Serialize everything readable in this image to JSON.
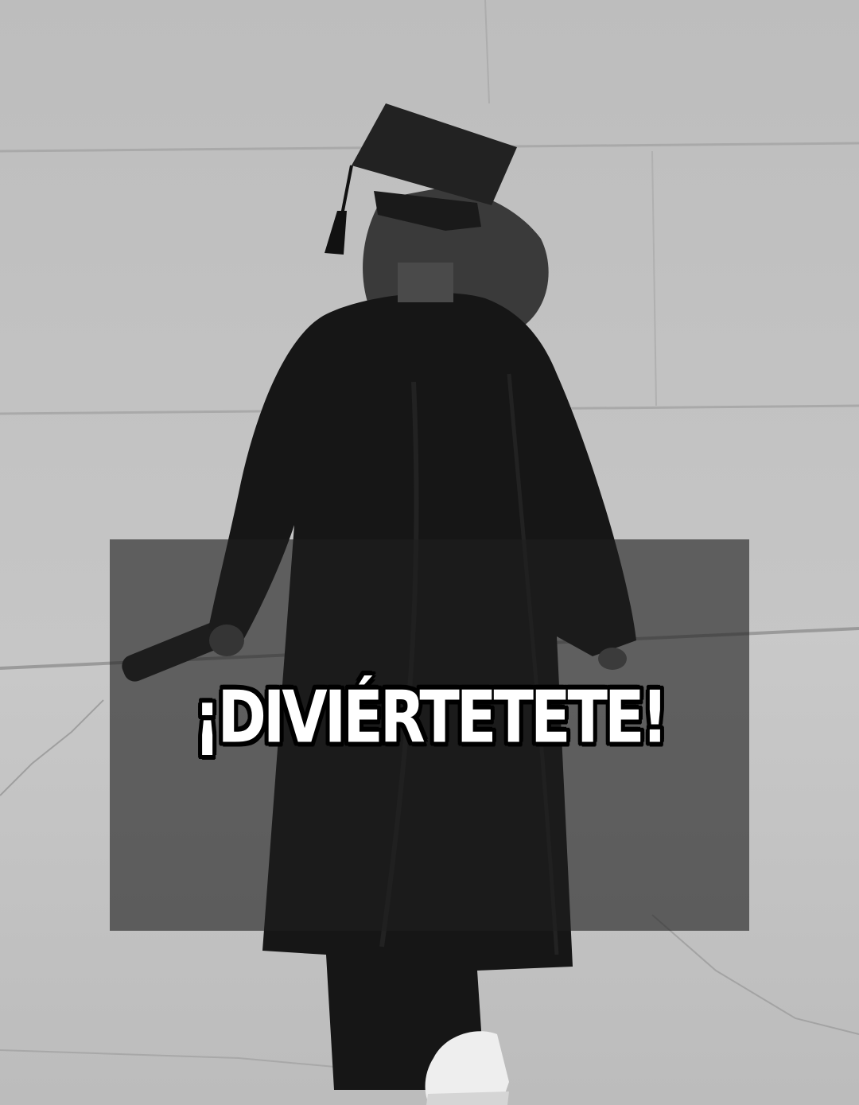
{
  "caption": {
    "text": "¡DIVIÉRTETETE!"
  },
  "colors": {
    "caption_text": "#ffffff",
    "caption_outline": "#000000",
    "overlay": "rgba(30,30,30,0.62)"
  }
}
